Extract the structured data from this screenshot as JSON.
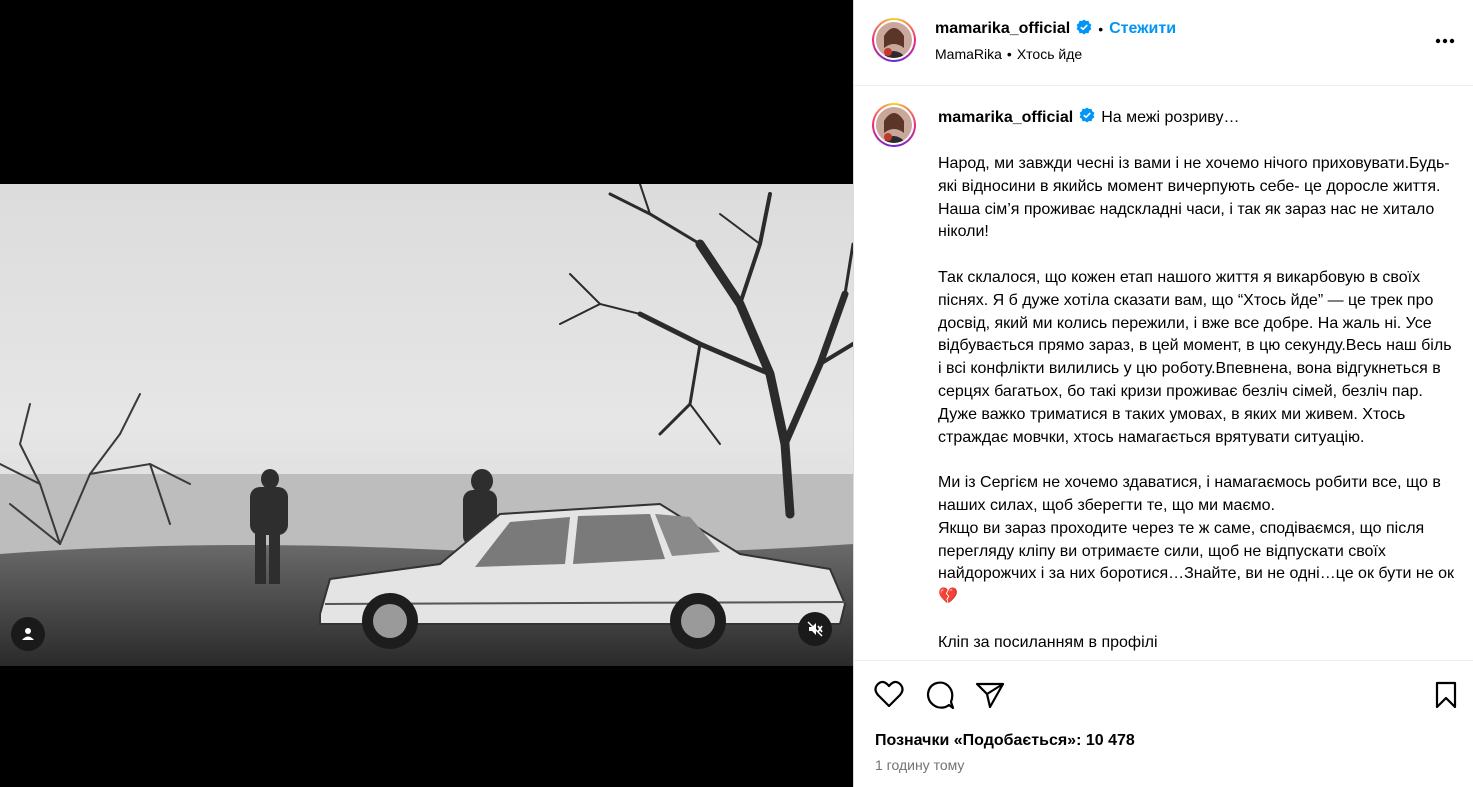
{
  "post": {
    "username": "mamarika_official",
    "follow_label": "Стежити",
    "separator": "•",
    "audio_artist": "MamaRika",
    "audio_track": "Хтось йде",
    "more_label": "•••"
  },
  "caption": {
    "username": "mamarika_official",
    "title": "На межі розриву…",
    "paragraphs": [
      "Народ, ми завжди чесні із вами і не хочемо нічого приховувати.Будь-які відносини в якийсь момент вичерпують себе- це доросле життя. Наша сім’я проживає надскладні часи, і так як зараз нас не хитало ніколи!",
      "Так склалося, що кожен етап нашого життя я викарбовую в своїх піснях. Я б дуже хотіла сказати вам, що “Хтось йде” — це трек про досвід, який ми колись пережили, і вже все добре. На жаль ні. Усе відбувається прямо зараз, в цей момент, в цю секунду.Весь наш біль і всі конфлікти вилились у цю роботу.Впевнена, вона відгукнеться в серцях багатьох, бо такі кризи проживає безліч сімей, безліч пар. Дуже важко триматися в таких умовах, в яких ми живем. Хтось страждає мовчки, хтось намагається врятувати ситуацію.",
      "Ми із Сергієм не хочемо здаватися, і намагаємось робити все, що в наших силах, щоб зберегти те, що ми маємо.\nЯкщо ви зараз проходите через те ж саме, сподіваємся, що після перегляду кліпу ви отримаєте сили, щоб не відпускати своїх найдорожчих і за них боротися…Знайте, ви не одні…це ок бути не ок💔",
      "Кліп за посиланням в профілі"
    ]
  },
  "engagement": {
    "likes_label": "Позначки «Подобається»: 10 478",
    "time_ago": "1 годину тому"
  },
  "icons": {
    "like": "heart-icon",
    "comment": "comment-icon",
    "share": "share-icon",
    "save": "bookmark-icon",
    "mute": "muted-speaker-icon",
    "tags": "user-tag-icon"
  },
  "colors": {
    "accent": "#0095f6",
    "verified": "#0095f6",
    "broken_heart": "#d0021b"
  }
}
